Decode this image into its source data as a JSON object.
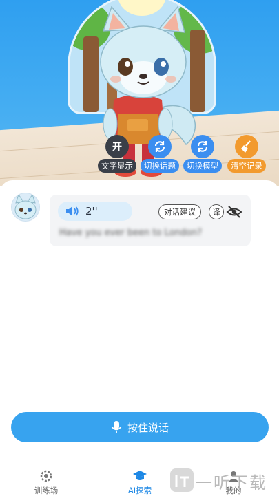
{
  "hero": {
    "actions": [
      {
        "icon": "toggle-text",
        "label": "文字显示",
        "badge": "开"
      },
      {
        "icon": "refresh-icon",
        "label": "切换话题"
      },
      {
        "icon": "refresh-icon",
        "label": "切换模型"
      },
      {
        "icon": "broom-icon",
        "label": "清空记录"
      }
    ]
  },
  "chat": {
    "voice_duration": "2''",
    "suggest_label": "对话建议",
    "translate_label": "译",
    "sentence": "Have you ever been to London?"
  },
  "talk_button": {
    "label": "按住说话"
  },
  "nav": {
    "items": [
      {
        "label": "训练场",
        "icon": "gear-icon"
      },
      {
        "label": "AI探索",
        "icon": "graduation-cap-icon",
        "active": true
      },
      {
        "label": "我的",
        "icon": "profile-icon"
      }
    ]
  },
  "watermark": {
    "text": "一听下载"
  },
  "colors": {
    "accent": "#37a3ef",
    "action_dark": "#3a3f48",
    "action_blue": "#3b8ef0",
    "action_orange": "#f29a2e",
    "nav_active": "#1e88e5"
  }
}
